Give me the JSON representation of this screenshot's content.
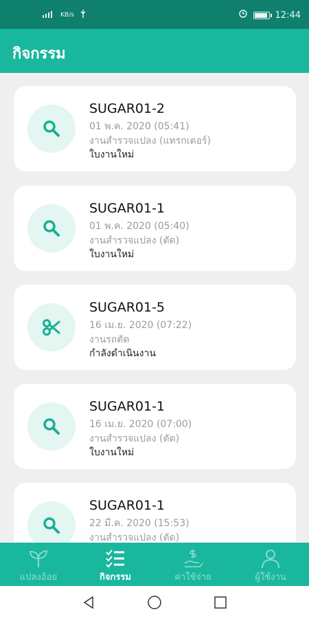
{
  "status_bar": {
    "time": "12:44",
    "network_label": "KB/s",
    "battery_level": 0.9
  },
  "header": {
    "title": "กิจกรรม"
  },
  "activities": [
    {
      "title": "SUGAR01-2",
      "date": "01 พ.ค. 2020 (05:41)",
      "type": "งานสำรวจแปลง (แทรกเตอร์)",
      "status": "ใบงานใหม่",
      "icon": "search-icon"
    },
    {
      "title": "SUGAR01-1",
      "date": "01 พ.ค. 2020 (05:40)",
      "type": "งานสำรวจแปลง (ตัด)",
      "status": "ใบงานใหม่",
      "icon": "search-icon"
    },
    {
      "title": "SUGAR01-5",
      "date": "16 เม.ย. 2020 (07:22)",
      "type": "งานรถตัด",
      "status": "กำลังดำเนินงาน",
      "icon": "scissors-icon"
    },
    {
      "title": "SUGAR01-1",
      "date": "16 เม.ย. 2020 (07:00)",
      "type": "งานสำรวจแปลง (ตัด)",
      "status": "ใบงานใหม่",
      "icon": "search-icon"
    },
    {
      "title": "SUGAR01-1",
      "date": "22 มี.ค. 2020 (15:53)",
      "type": "งานสำรวจแปลง (ตัด)",
      "status": "",
      "icon": "search-icon"
    }
  ],
  "bottom_nav": [
    {
      "label": "แปลงอ้อย",
      "icon": "sprout-icon",
      "active": false
    },
    {
      "label": "กิจกรรม",
      "icon": "checklist-icon",
      "active": true
    },
    {
      "label": "ค่าใช้จ่าย",
      "icon": "money-hand-icon",
      "active": false
    },
    {
      "label": "ผู้ใช้งาน",
      "icon": "user-icon",
      "active": false
    }
  ],
  "colors": {
    "primary": "#19b79e",
    "status_bar": "#0f7f6e",
    "icon_background": "#e3f6f1",
    "icon": "#1aae96"
  }
}
